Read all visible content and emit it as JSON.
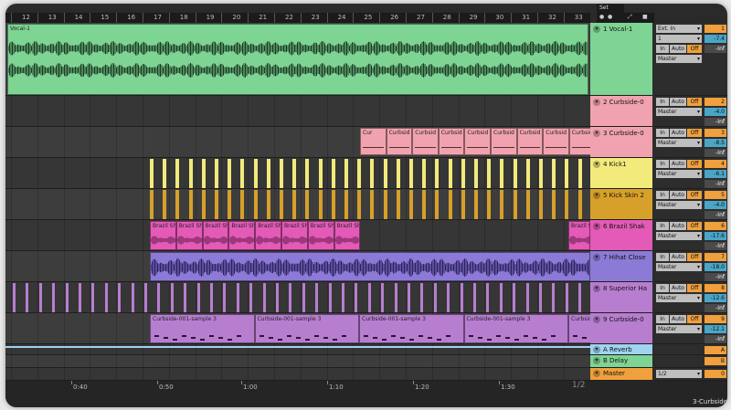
{
  "browser": {
    "set_label": "Set"
  },
  "ruler": {
    "bars": [
      "12",
      "13",
      "14",
      "15",
      "16",
      "17",
      "18",
      "19",
      "20",
      "21",
      "22",
      "23",
      "24",
      "25",
      "26",
      "27",
      "28",
      "29",
      "30",
      "31",
      "32",
      "33"
    ]
  },
  "timeline": {
    "times": [
      "0:40",
      "0:50",
      "1:00",
      "1:10",
      "1:20",
      "1:30"
    ],
    "zoom": "1/2",
    "bottom_track": "3-Curbside"
  },
  "tracks": [
    {
      "header": "1 Vocal-1",
      "color": "#7ed493",
      "clip_title": "Vocal-1"
    },
    {
      "header": "2 Curbside-0",
      "color": "#f0a3ae"
    },
    {
      "header": "3 Curbside-0",
      "color": "#f0a3ae",
      "clip_label": "Cur",
      "clip_label_long": "Curbsid"
    },
    {
      "header": "4 Kick1",
      "color": "#f2ea7a"
    },
    {
      "header": "5 Kick Skin 2",
      "color": "#d7a02a"
    },
    {
      "header": "6 Brazil Shak",
      "color": "#e35ab7",
      "clip_label": "Brazil Sh"
    },
    {
      "header": "7 Hihat Close",
      "color": "#8c7ad6"
    },
    {
      "header": "8 Superior Ha",
      "color": "#b77ed0"
    },
    {
      "header": "9 Curbside-0",
      "color": "#b77ed0",
      "clip_label": "Curbside-001-sample 3"
    }
  ],
  "returns": [
    {
      "header": "A Reverb",
      "color": "#9fd3f0"
    },
    {
      "header": "B Delay",
      "color": "#7ed493"
    },
    {
      "header": "Master",
      "color": "#f0a03c"
    }
  ],
  "mixer": {
    "input": "Ext. In",
    "input_channel": "1",
    "in": "In",
    "auto": "Auto",
    "off": "Off",
    "output": "Master",
    "neg_inf": "-Inf",
    "master_output": "1/2",
    "rows": [
      {
        "num": "1",
        "vol": "-7.4"
      },
      {
        "num": "2",
        "vol": "-4.0"
      },
      {
        "num": "3",
        "vol": "-8.5"
      },
      {
        "num": "4",
        "vol": "-6.1"
      },
      {
        "num": "5",
        "vol": "-4.0"
      },
      {
        "num": "6",
        "vol": "-17.6"
      },
      {
        "num": "7",
        "vol": "-18.0"
      },
      {
        "num": "8",
        "vol": "-12.6"
      },
      {
        "num": "9",
        "vol": "-12.1"
      }
    ],
    "return_nums": [
      "A",
      "B",
      "0"
    ]
  },
  "colors": {
    "accent": "#f0a03c",
    "blue": "#4aa6c7"
  }
}
